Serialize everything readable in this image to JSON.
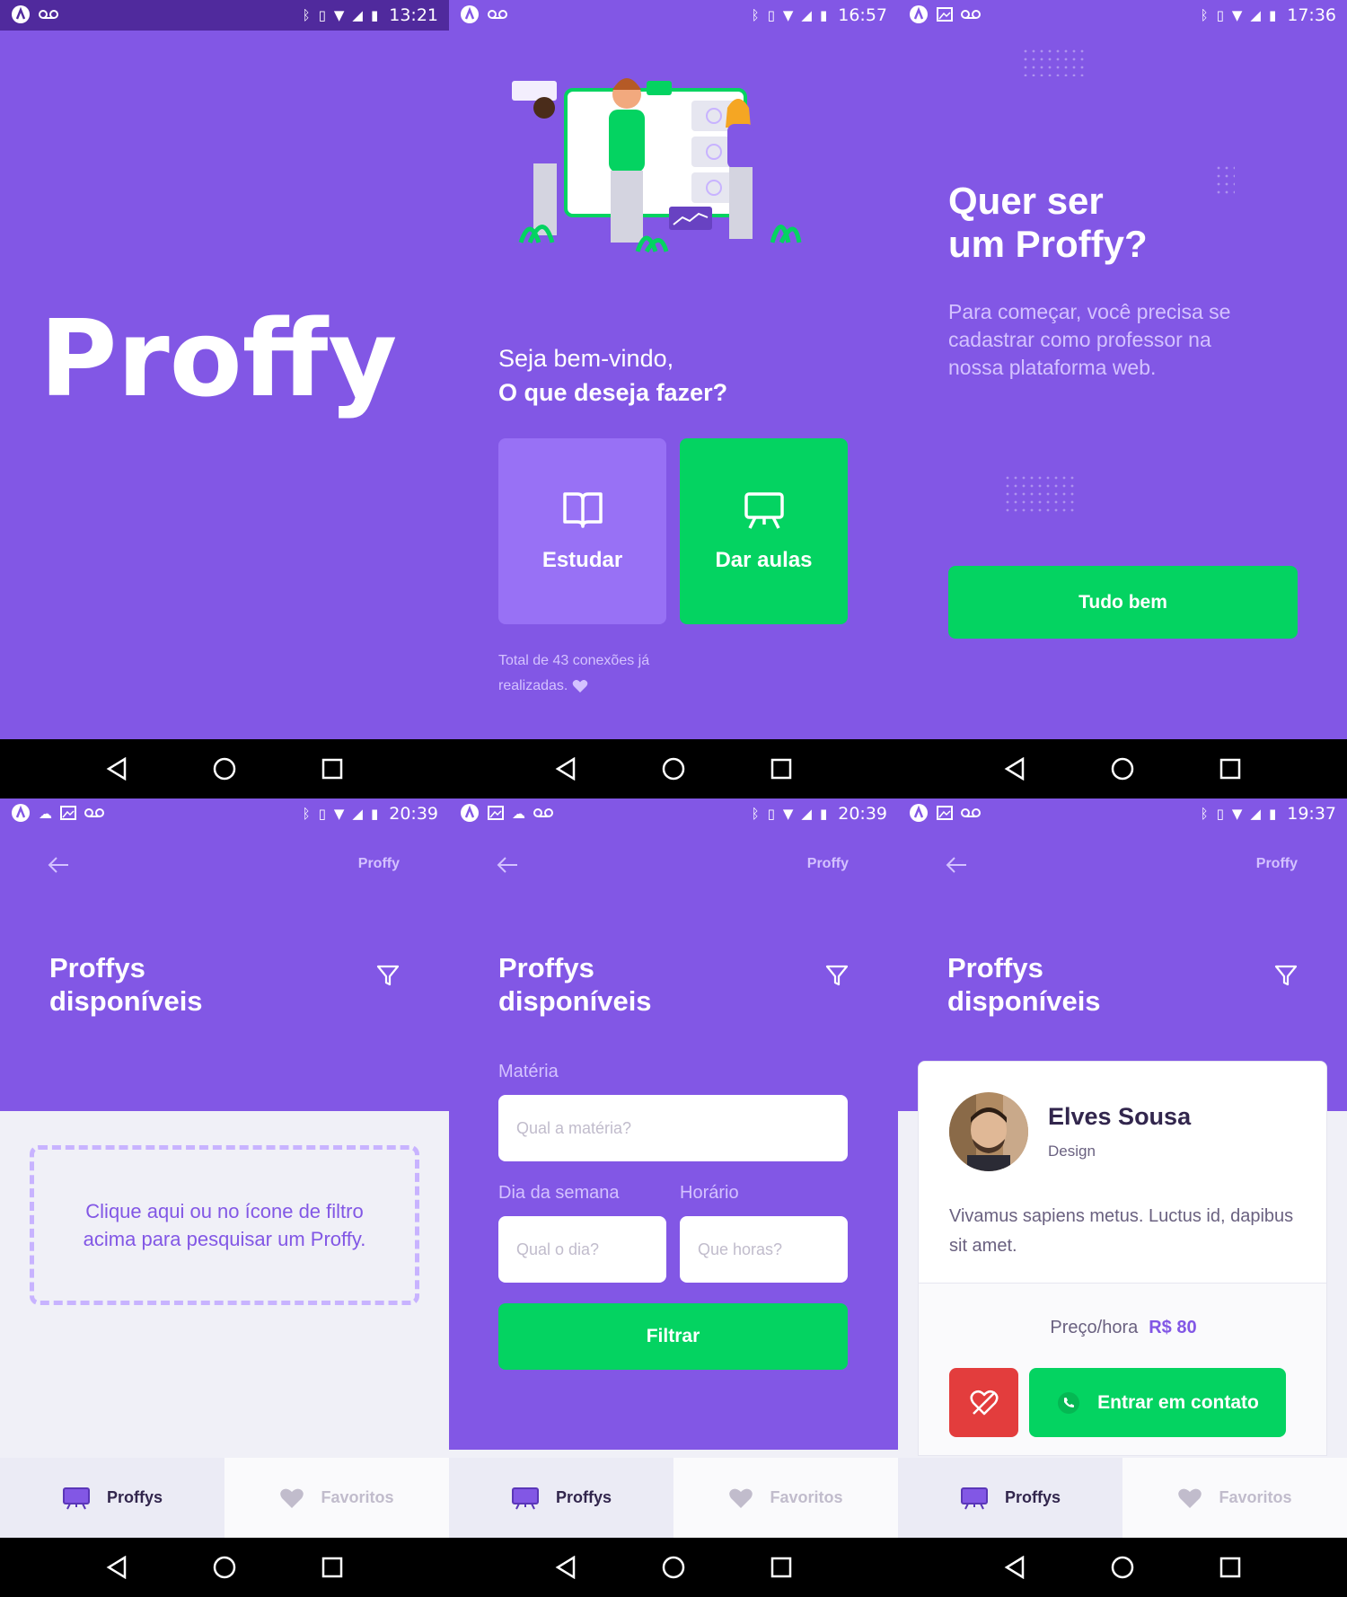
{
  "colors": {
    "primary": "#8257e5",
    "primary_light": "#9871f5",
    "secondary": "#04d361",
    "danger": "#e33d3d",
    "bg": "#f0f0f7",
    "text_title": "#32264d",
    "text_muted": "#c1bccc"
  },
  "screens": [
    {
      "status": {
        "time": "13:21",
        "icons": [
          "app-icon",
          "voicemail-icon"
        ]
      },
      "logo_text": "Proffy"
    },
    {
      "status": {
        "time": "16:57",
        "icons": [
          "app-icon",
          "voicemail-icon"
        ]
      },
      "welcome_line1": "Seja bem-vindo,",
      "welcome_line2": "O que deseja fazer?",
      "study_label": "Estudar",
      "teach_label": "Dar aulas",
      "connections_text": "Total de 43 conexões já realizadas."
    },
    {
      "status": {
        "time": "17:36",
        "icons": [
          "app-icon",
          "image-icon",
          "voicemail-icon"
        ]
      },
      "title_line1": "Quer ser",
      "title_line2": "um Proffy?",
      "description": "Para começar, você precisa se cadastrar como professor na nossa plataforma web.",
      "ok_label": "Tudo bem"
    },
    {
      "status": {
        "time": "20:39",
        "icons": [
          "app-icon",
          "cloud-icon",
          "image-icon",
          "voicemail-icon"
        ]
      },
      "header_logo": "Proffy",
      "title_line1": "Proffys",
      "title_line2": "disponíveis",
      "hint": "Clique aqui ou no ícone de filtro acima para pesquisar um Proffy.",
      "tabs": {
        "proffys": "Proffys",
        "favorites": "Favoritos"
      }
    },
    {
      "status": {
        "time": "20:39",
        "icons": [
          "app-icon",
          "image-icon",
          "cloud-icon",
          "voicemail-icon"
        ]
      },
      "header_logo": "Proffy",
      "title_line1": "Proffys",
      "title_line2": "disponíveis",
      "subject_label": "Matéria",
      "subject_placeholder": "Qual a matéria?",
      "weekday_label": "Dia da semana",
      "weekday_placeholder": "Qual o dia?",
      "time_label": "Horário",
      "time_placeholder": "Que horas?",
      "filter_button": "Filtrar",
      "tabs": {
        "proffys": "Proffys",
        "favorites": "Favoritos"
      }
    },
    {
      "status": {
        "time": "19:37",
        "icons": [
          "app-icon",
          "image-icon",
          "voicemail-icon"
        ]
      },
      "header_logo": "Proffy",
      "title_line1": "Proffys",
      "title_line2": "disponíveis",
      "teacher": {
        "name": "Elves Sousa",
        "subject": "Design",
        "bio": "Vivamus sapiens metus. Luctus id, dapibus sit amet.",
        "price_label": "Preço/hora",
        "price_value": "R$ 80",
        "contact_label": "Entrar em contato"
      },
      "tabs": {
        "proffys": "Proffys",
        "favorites": "Favoritos"
      }
    }
  ]
}
